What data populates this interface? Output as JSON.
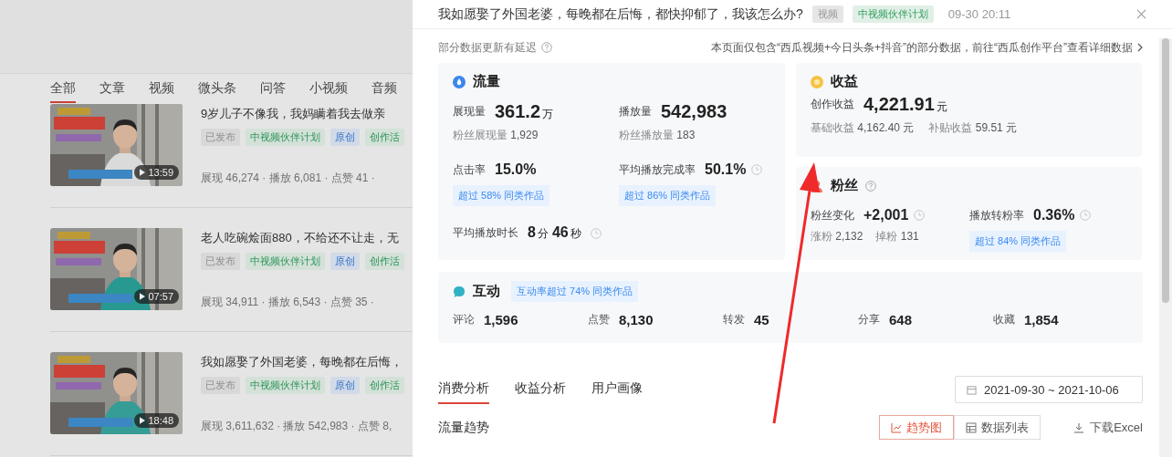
{
  "background": {
    "tabs": [
      {
        "label": "全部",
        "selected": true
      },
      {
        "label": "文章",
        "selected": false
      },
      {
        "label": "视频",
        "selected": false
      },
      {
        "label": "微头条",
        "selected": false
      },
      {
        "label": "问答",
        "selected": false
      },
      {
        "label": "小视频",
        "selected": false
      },
      {
        "label": "音频",
        "selected": false
      }
    ],
    "videos": [
      {
        "title": "9岁儿子不像我，我妈瞒着我去做亲",
        "duration": "13:59",
        "tags": [
          {
            "label": "已发布",
            "kind": "status"
          },
          {
            "label": "中视频伙伴计划",
            "kind": "plan"
          },
          {
            "label": "原创",
            "kind": "original"
          },
          {
            "label": "创作活",
            "kind": "activity"
          }
        ],
        "stats": "展现 46,274 · 播放 6,081 · 点赞 41 ·"
      },
      {
        "title": "老人吃碗烩面880，不给还不让走，无",
        "duration": "07:57",
        "tags": [
          {
            "label": "已发布",
            "kind": "status"
          },
          {
            "label": "中视频伙伴计划",
            "kind": "plan"
          },
          {
            "label": "原创",
            "kind": "original"
          },
          {
            "label": "创作活",
            "kind": "activity"
          }
        ],
        "stats": "展现 34,911 · 播放 6,543 · 点赞 35 ·"
      },
      {
        "title": "我如愿娶了外国老婆，每晚都在后悔，",
        "duration": "18:48",
        "tags": [
          {
            "label": "已发布",
            "kind": "status"
          },
          {
            "label": "中视频伙伴计划",
            "kind": "plan"
          },
          {
            "label": "原创",
            "kind": "original"
          },
          {
            "label": "创作活",
            "kind": "activity"
          }
        ],
        "stats": "展现 3,611,632 · 播放 542,983 · 点赞 8,"
      }
    ]
  },
  "drawer": {
    "title": "我如愿娶了外国老婆，每晚都在后悔，都快抑郁了，我该怎么办?",
    "tags": [
      {
        "label": "视频",
        "kind": "type"
      },
      {
        "label": "中视频伙伴计划",
        "kind": "plan"
      }
    ],
    "time": "09-30 20:11",
    "notice": "部分数据更新有延迟",
    "scope_note": "本页面仅包含“西瓜视频+今日头条+抖音”的部分数据，前往“西瓜创作平台”查看详细数据",
    "traffic": {
      "title": "流量",
      "metrics": [
        {
          "label": "展现量",
          "segments": [
            {
              "text": "361.2",
              "kind": "big"
            },
            {
              "text": "万",
              "kind": "unit"
            }
          ],
          "subs": [
            {
              "label": "粉丝展现量",
              "value": "1,929"
            }
          ]
        },
        {
          "label": "播放量",
          "segments": [
            {
              "text": "542,983",
              "kind": "big"
            }
          ],
          "subs": [
            {
              "label": "粉丝播放量",
              "value": "183"
            }
          ]
        },
        {
          "label": "点击率",
          "segments": [
            {
              "text": "15.0%",
              "kind": "number"
            }
          ],
          "badge": "超过 58% 同类作品"
        },
        {
          "label": "平均播放完成率",
          "segments": [
            {
              "text": "50.1%",
              "kind": "number"
            }
          ],
          "trend_icon": true,
          "badge": "超过 86% 同类作品"
        },
        {
          "label": "平均播放时长",
          "segments": [
            {
              "text": "8",
              "kind": "number"
            },
            {
              "text": "分",
              "kind": "unit"
            },
            {
              "text": "46",
              "kind": "number"
            },
            {
              "text": "秒",
              "kind": "unit"
            }
          ],
          "trend_icon": true
        }
      ]
    },
    "income": {
      "title": "收益",
      "metrics": [
        {
          "label": "创作收益",
          "segments": [
            {
              "text": "4,221.91",
              "kind": "big"
            },
            {
              "text": "元",
              "kind": "unit"
            }
          ],
          "subs": [
            {
              "label": "基础收益",
              "value": "4,162.40 元"
            },
            {
              "label": "补贴收益",
              "value": "59.51 元"
            }
          ]
        }
      ]
    },
    "fans": {
      "title": "粉丝",
      "metrics": [
        {
          "label": "粉丝变化",
          "segments": [
            {
              "text": "+2,001",
              "kind": "number"
            }
          ],
          "trend_icon": true,
          "subs": [
            {
              "label": "涨粉",
              "value": "2,132"
            },
            {
              "label": "掉粉",
              "value": "131"
            }
          ]
        },
        {
          "label": "播放转粉率",
          "segments": [
            {
              "text": "0.36%",
              "kind": "number"
            }
          ],
          "trend_icon": true,
          "badge": "超过 84% 同类作品"
        }
      ]
    },
    "interaction": {
      "title": "互动",
      "badge": "互动率超过 74% 同类作品",
      "items": [
        {
          "label": "评论",
          "value": "1,596"
        },
        {
          "label": "点赞",
          "value": "8,130"
        },
        {
          "label": "转发",
          "value": "45"
        },
        {
          "label": "分享",
          "value": "648"
        },
        {
          "label": "收藏",
          "value": "1,854"
        }
      ]
    },
    "tabs": [
      {
        "label": "消费分析",
        "selected": true
      },
      {
        "label": "收益分析",
        "selected": false
      },
      {
        "label": "用户画像",
        "selected": false
      }
    ],
    "date_range": "2021-09-30 ~ 2021-10-06",
    "section_title": "流量趋势",
    "views": [
      {
        "label": "趋势图",
        "kind": "chart",
        "selected": true
      },
      {
        "label": "数据列表",
        "kind": "table",
        "selected": false
      }
    ],
    "download": "下载Excel"
  }
}
